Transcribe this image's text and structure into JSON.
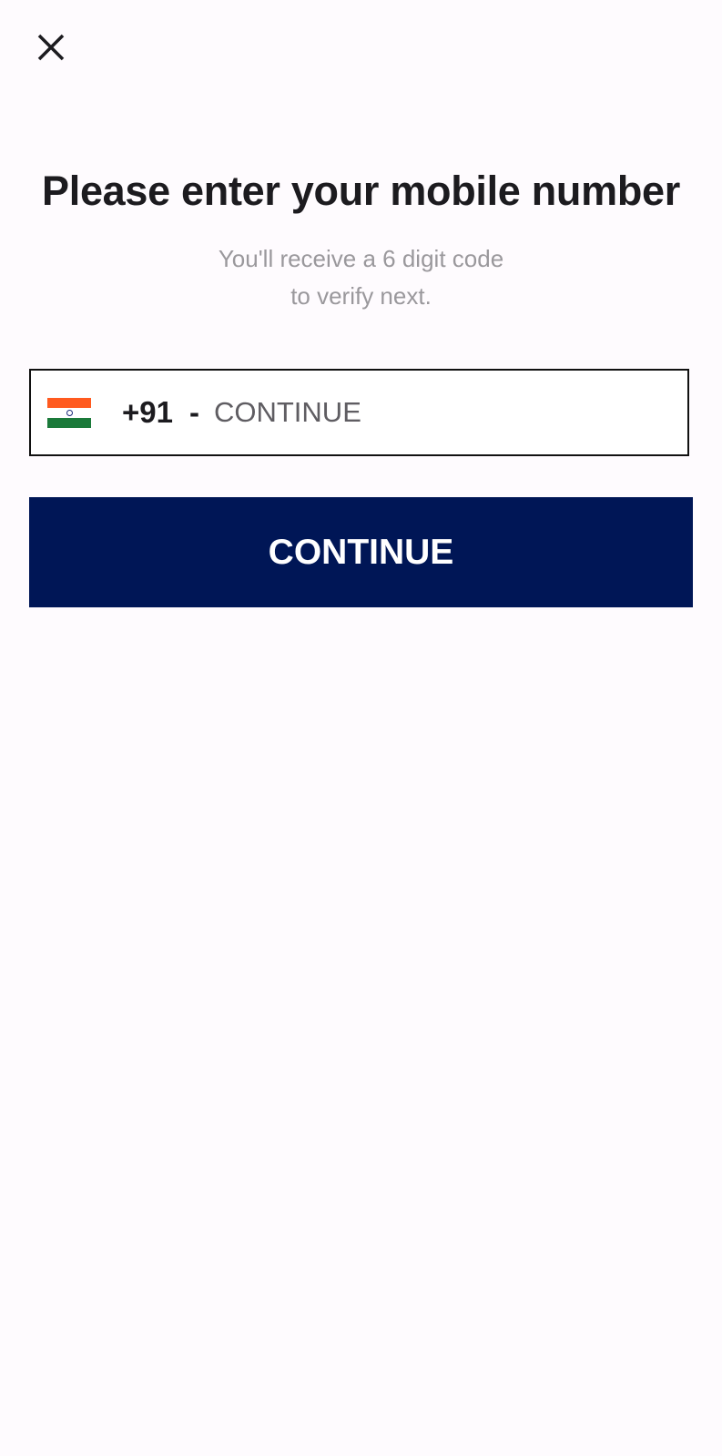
{
  "header": {
    "close_icon": "close-icon"
  },
  "title": "Please enter your mobile number",
  "subtitle": {
    "line1": "You'll receive a 6 digit code",
    "line2": "to verify next."
  },
  "phone_field": {
    "flag_icon": "india-flag-icon",
    "country_code": "+91",
    "separator": "-",
    "placeholder": "CONTINUE"
  },
  "continue_button": {
    "label": "CONTINUE",
    "color": "#001656"
  },
  "flag_colors": {
    "saffron": "#ff5a1f",
    "white": "#ffffff",
    "green": "#1b7a3a",
    "chakra": "#1a2a7a"
  }
}
